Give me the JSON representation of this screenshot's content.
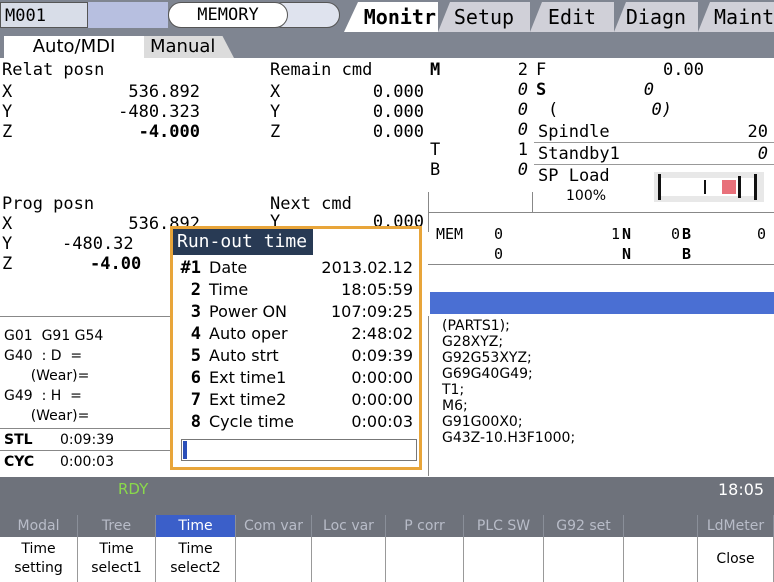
{
  "top": {
    "model": "M001",
    "mode": "MEMORY",
    "tabs": [
      "Monitr",
      "Setup",
      "Edit",
      "Diagn",
      "Mainte"
    ]
  },
  "subtabs": [
    "Auto/MDI",
    "Manual"
  ],
  "relat": {
    "title": "Relat posn",
    "rows": [
      [
        "X",
        "536.892"
      ],
      [
        "Y",
        "-480.323"
      ],
      [
        "Z",
        "-4.000"
      ]
    ]
  },
  "remain": {
    "title": "Remain cmd",
    "rows": [
      [
        "X",
        "0.000"
      ],
      [
        "Y",
        "0.000"
      ],
      [
        "Z",
        "0.000"
      ]
    ]
  },
  "prog": {
    "title": "Prog posn",
    "rows": [
      [
        "X",
        "536.892"
      ],
      [
        "Y",
        "-480.32"
      ],
      [
        "Z",
        "-4.00"
      ]
    ]
  },
  "next": {
    "title": "Next cmd",
    "first_label": "Y",
    "first_val": "0.000"
  },
  "mcodes": {
    "m_label": "M",
    "m_val": "2",
    "v2": "0",
    "v3": "0",
    "v4": "0",
    "t_label": "T",
    "t_val": "1",
    "b_label": "B",
    "b_val": "0"
  },
  "fs": {
    "f_label": "F",
    "f_val": "0.00",
    "s_label": "S",
    "s_val": "0",
    "paren": "(",
    "paren_val": "0)",
    "spindle_label": "Spindle",
    "spindle_val": "20",
    "standby_label": "Standby1",
    "standby_val": "0",
    "spload_label": "SP Load",
    "spload_pct": "100%"
  },
  "mem": {
    "label": "MEM",
    "r1": [
      "0",
      "1",
      "N",
      "0",
      "B",
      "0"
    ],
    "r2": [
      "0",
      "N",
      "B"
    ]
  },
  "program": [
    "(PARTS1);",
    "G28XYZ;",
    "G92G53XYZ;",
    "G69G40G49;",
    "T1;",
    "M6;",
    "G91G00X0;",
    "G43Z-10.H3F1000;"
  ],
  "modal": {
    "l1": "G01  G91 G54",
    "l2": "G40  : D  =",
    "l3": "      (Wear)=",
    "l4": "G49  : H  =",
    "l5": "      (Wear)=",
    "stl_label": "STL",
    "stl_val": "0:09:39",
    "cyc_label": "CYC",
    "cyc_val": "0:00:03"
  },
  "popup": {
    "title": "Run-out time",
    "rows": [
      {
        "n": "#1",
        "label": "Date",
        "value": "2013.02.12"
      },
      {
        "n": "2",
        "label": "Time",
        "value": "18:05:59"
      },
      {
        "n": "3",
        "label": "Power ON",
        "value": "107:09:25"
      },
      {
        "n": "4",
        "label": "Auto oper",
        "value": "2:48:02"
      },
      {
        "n": "5",
        "label": "Auto strt",
        "value": "0:09:39"
      },
      {
        "n": "6",
        "label": "Ext time1",
        "value": "0:00:00"
      },
      {
        "n": "7",
        "label": "Ext time2",
        "value": "0:00:00"
      },
      {
        "n": "8",
        "label": "Cycle time",
        "value": "0:00:03"
      }
    ]
  },
  "status": {
    "rdy": "RDY",
    "clock": "18:05"
  },
  "fkeys_upper": [
    "Modal",
    "Tree",
    "Time",
    "Com var",
    "Loc var",
    "P corr",
    "PLC SW",
    "G92 set",
    "",
    "LdMeter"
  ],
  "fkeys_lower": [
    [
      "Time",
      "setting"
    ],
    [
      "Time",
      "select1"
    ],
    [
      "Time",
      "select2"
    ],
    [
      "",
      ""
    ],
    [
      "",
      ""
    ],
    [
      "",
      ""
    ],
    [
      "",
      ""
    ],
    [
      "",
      ""
    ],
    [
      "",
      ""
    ],
    [
      "Close",
      ""
    ]
  ],
  "colors": {
    "accent_orange": "#e8a53a",
    "title_navy": "#283a54",
    "rdy_green": "#8ad94b",
    "load_red": "#e8707a"
  }
}
